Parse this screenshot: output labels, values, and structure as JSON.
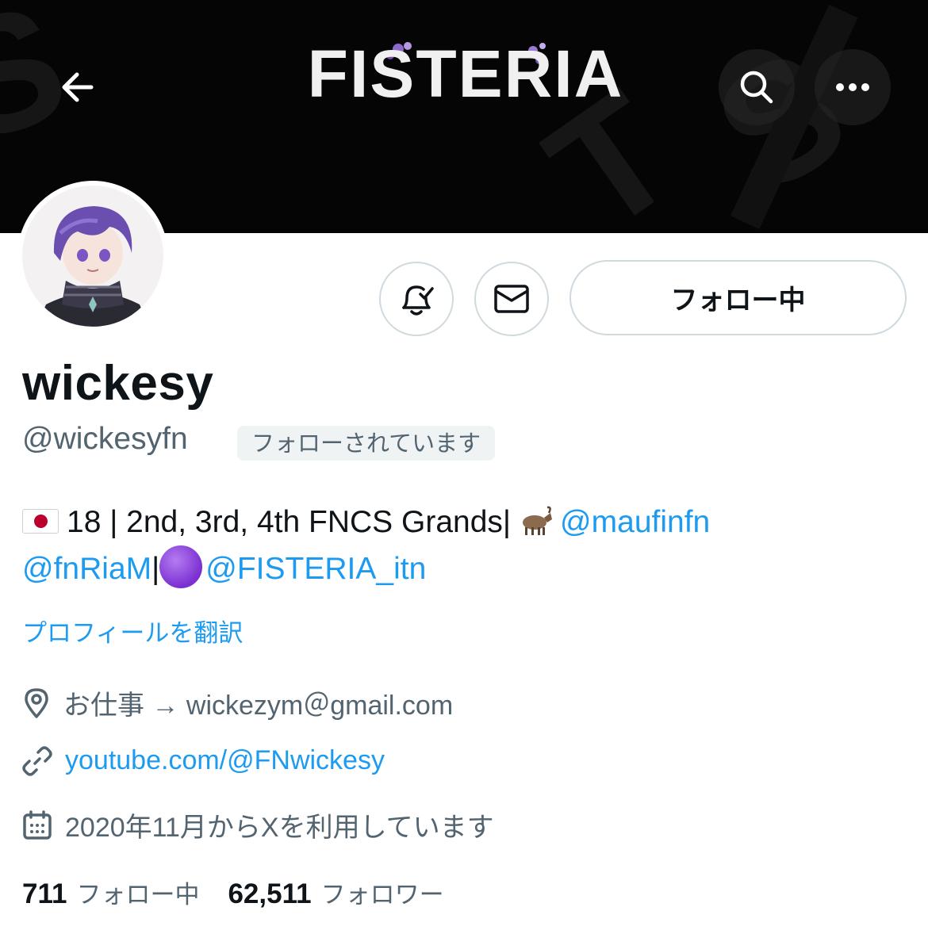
{
  "banner": {
    "logo_text": "FISTERIA",
    "nav": {
      "back_icon": "arrow-left-icon",
      "search_icon": "search-icon",
      "more_icon": "more-horizontal-icon"
    }
  },
  "profile": {
    "avatar_icon": "avatar",
    "actions": {
      "notification_icon": "bell-check-icon",
      "message_icon": "envelope-icon",
      "follow_label": "フォロー中"
    },
    "display_name": "wickesy",
    "handle": "@wickesyfn",
    "follows_you_badge": "フォローされています",
    "bio": {
      "part1": "18 | 2nd, 3rd, 4th FNCS Grands|",
      "mention1": "@maufinfn",
      "mention2": "@fnRiaM",
      "separator": "|",
      "mention3": "@FISTERIA_itn"
    },
    "translate_label": "プロフィールを翻訳",
    "location": "お仕事 → wickezym＠gmail.com",
    "website": "youtube.com/@FNwickesy",
    "joined": "2020年11月からXを利用しています",
    "stats": {
      "following_count": "711",
      "following_label": "フォロー中",
      "followers_count": "62,511",
      "followers_label": "フォロワー"
    }
  },
  "colors": {
    "accent": "#1d9bf0",
    "secondary_text": "#536471",
    "banner_bg": "#050505",
    "button_border": "#cfd9de"
  }
}
